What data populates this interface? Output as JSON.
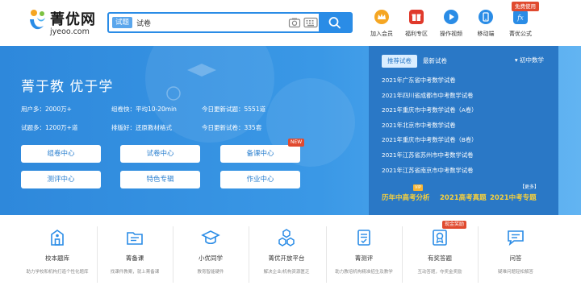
{
  "header": {
    "logo": {
      "title": "菁优网",
      "domain": "jyeoo.com"
    },
    "search": {
      "type_tag": "试题",
      "value": "试卷"
    },
    "quick_links": [
      {
        "label": "加入会员",
        "color": "#f5a623"
      },
      {
        "label": "福利专区",
        "color": "#e0392b"
      },
      {
        "label": "操作视频",
        "color": "#2a8ce6"
      },
      {
        "label": "移动端",
        "color": "#2a8ce6"
      },
      {
        "label": "菁优公式",
        "color": "#2a8ce6"
      }
    ],
    "free_badge": "免费使用"
  },
  "banner": {
    "slogan": "菁于教 优于学",
    "stats": [
      "用户多：2000万+",
      "组卷快：平均10-20min",
      "今日更新试题：5551道",
      "试题多：1200万+道",
      "排版好：还原教材格式",
      "今日更新试卷：335套"
    ],
    "buttons": [
      "组卷中心",
      "试卷中心",
      "备课中心",
      "测评中心",
      "特色专辑",
      "作业中心"
    ],
    "new_badge": "NEW"
  },
  "panel": {
    "tabs": [
      "推荐试卷",
      "最新试卷"
    ],
    "subject": "初中数学",
    "papers": [
      "2021年广东省中考数学试卷",
      "2021年四川省成都市中考数学试卷",
      "2021年重庆市中考数学试卷（A卷）",
      "2021年北京市中考数学试卷",
      "2021年重庆市中考数学试卷（B卷）",
      "2021年江苏省苏州市中考数学试卷",
      "2021年江苏省南京市中考数学试卷"
    ],
    "more": "【更多】",
    "vip_badge": "VIP",
    "promos": [
      "历年中高考分析",
      "2021高考真题",
      "2021中考专题"
    ]
  },
  "features": {
    "items": [
      {
        "title": "校本题库",
        "desc": "助力学校和机构打造个性化题库"
      },
      {
        "title": "菁备课",
        "desc": "找课件教案，就上菁备课"
      },
      {
        "title": "小优同学",
        "desc": "教育智能硬件"
      },
      {
        "title": "菁优开放平台",
        "desc": "解决企业/机构资源匮乏"
      },
      {
        "title": "菁测评",
        "desc": "助力教培机构精准招生及教学"
      },
      {
        "title": "有奖答题",
        "desc": "互动答题，夺奖金奖励"
      },
      {
        "title": "问答",
        "desc": "疑难问题轻松解答"
      }
    ],
    "reward_badge": "现金奖励"
  },
  "colors": {
    "brand_blue": "#2a8ce6",
    "panel_blue": "#2a78c6",
    "badge_red": "#e04a2f",
    "promo_yellow": "#f7d03c"
  }
}
